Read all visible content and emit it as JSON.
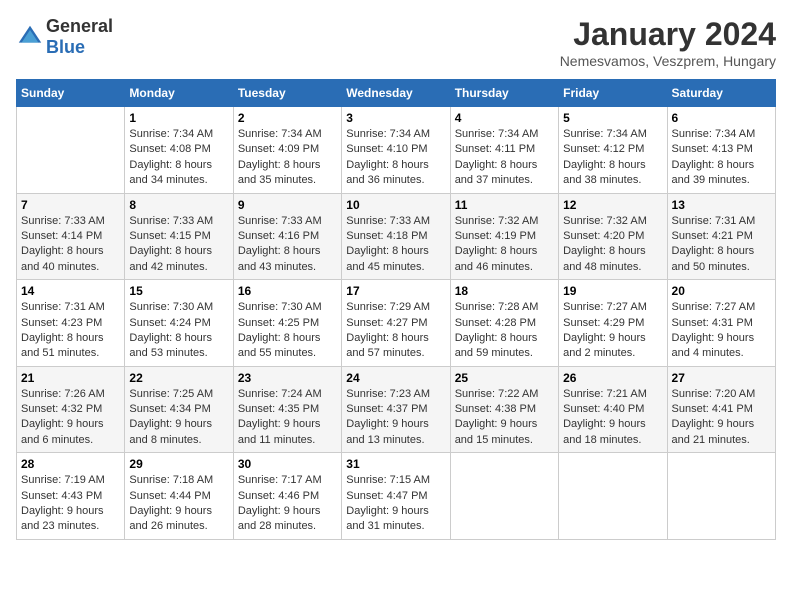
{
  "header": {
    "logo": {
      "text_general": "General",
      "text_blue": "Blue"
    },
    "title": "January 2024",
    "subtitle": "Nemesvamos, Veszprem, Hungary"
  },
  "calendar": {
    "days_of_week": [
      "Sunday",
      "Monday",
      "Tuesday",
      "Wednesday",
      "Thursday",
      "Friday",
      "Saturday"
    ],
    "weeks": [
      [
        {
          "day": "",
          "sunrise": "",
          "sunset": "",
          "daylight": ""
        },
        {
          "day": "1",
          "sunrise": "Sunrise: 7:34 AM",
          "sunset": "Sunset: 4:08 PM",
          "daylight": "Daylight: 8 hours and 34 minutes."
        },
        {
          "day": "2",
          "sunrise": "Sunrise: 7:34 AM",
          "sunset": "Sunset: 4:09 PM",
          "daylight": "Daylight: 8 hours and 35 minutes."
        },
        {
          "day": "3",
          "sunrise": "Sunrise: 7:34 AM",
          "sunset": "Sunset: 4:10 PM",
          "daylight": "Daylight: 8 hours and 36 minutes."
        },
        {
          "day": "4",
          "sunrise": "Sunrise: 7:34 AM",
          "sunset": "Sunset: 4:11 PM",
          "daylight": "Daylight: 8 hours and 37 minutes."
        },
        {
          "day": "5",
          "sunrise": "Sunrise: 7:34 AM",
          "sunset": "Sunset: 4:12 PM",
          "daylight": "Daylight: 8 hours and 38 minutes."
        },
        {
          "day": "6",
          "sunrise": "Sunrise: 7:34 AM",
          "sunset": "Sunset: 4:13 PM",
          "daylight": "Daylight: 8 hours and 39 minutes."
        }
      ],
      [
        {
          "day": "7",
          "sunrise": "Sunrise: 7:33 AM",
          "sunset": "Sunset: 4:14 PM",
          "daylight": "Daylight: 8 hours and 40 minutes."
        },
        {
          "day": "8",
          "sunrise": "Sunrise: 7:33 AM",
          "sunset": "Sunset: 4:15 PM",
          "daylight": "Daylight: 8 hours and 42 minutes."
        },
        {
          "day": "9",
          "sunrise": "Sunrise: 7:33 AM",
          "sunset": "Sunset: 4:16 PM",
          "daylight": "Daylight: 8 hours and 43 minutes."
        },
        {
          "day": "10",
          "sunrise": "Sunrise: 7:33 AM",
          "sunset": "Sunset: 4:18 PM",
          "daylight": "Daylight: 8 hours and 45 minutes."
        },
        {
          "day": "11",
          "sunrise": "Sunrise: 7:32 AM",
          "sunset": "Sunset: 4:19 PM",
          "daylight": "Daylight: 8 hours and 46 minutes."
        },
        {
          "day": "12",
          "sunrise": "Sunrise: 7:32 AM",
          "sunset": "Sunset: 4:20 PM",
          "daylight": "Daylight: 8 hours and 48 minutes."
        },
        {
          "day": "13",
          "sunrise": "Sunrise: 7:31 AM",
          "sunset": "Sunset: 4:21 PM",
          "daylight": "Daylight: 8 hours and 50 minutes."
        }
      ],
      [
        {
          "day": "14",
          "sunrise": "Sunrise: 7:31 AM",
          "sunset": "Sunset: 4:23 PM",
          "daylight": "Daylight: 8 hours and 51 minutes."
        },
        {
          "day": "15",
          "sunrise": "Sunrise: 7:30 AM",
          "sunset": "Sunset: 4:24 PM",
          "daylight": "Daylight: 8 hours and 53 minutes."
        },
        {
          "day": "16",
          "sunrise": "Sunrise: 7:30 AM",
          "sunset": "Sunset: 4:25 PM",
          "daylight": "Daylight: 8 hours and 55 minutes."
        },
        {
          "day": "17",
          "sunrise": "Sunrise: 7:29 AM",
          "sunset": "Sunset: 4:27 PM",
          "daylight": "Daylight: 8 hours and 57 minutes."
        },
        {
          "day": "18",
          "sunrise": "Sunrise: 7:28 AM",
          "sunset": "Sunset: 4:28 PM",
          "daylight": "Daylight: 8 hours and 59 minutes."
        },
        {
          "day": "19",
          "sunrise": "Sunrise: 7:27 AM",
          "sunset": "Sunset: 4:29 PM",
          "daylight": "Daylight: 9 hours and 2 minutes."
        },
        {
          "day": "20",
          "sunrise": "Sunrise: 7:27 AM",
          "sunset": "Sunset: 4:31 PM",
          "daylight": "Daylight: 9 hours and 4 minutes."
        }
      ],
      [
        {
          "day": "21",
          "sunrise": "Sunrise: 7:26 AM",
          "sunset": "Sunset: 4:32 PM",
          "daylight": "Daylight: 9 hours and 6 minutes."
        },
        {
          "day": "22",
          "sunrise": "Sunrise: 7:25 AM",
          "sunset": "Sunset: 4:34 PM",
          "daylight": "Daylight: 9 hours and 8 minutes."
        },
        {
          "day": "23",
          "sunrise": "Sunrise: 7:24 AM",
          "sunset": "Sunset: 4:35 PM",
          "daylight": "Daylight: 9 hours and 11 minutes."
        },
        {
          "day": "24",
          "sunrise": "Sunrise: 7:23 AM",
          "sunset": "Sunset: 4:37 PM",
          "daylight": "Daylight: 9 hours and 13 minutes."
        },
        {
          "day": "25",
          "sunrise": "Sunrise: 7:22 AM",
          "sunset": "Sunset: 4:38 PM",
          "daylight": "Daylight: 9 hours and 15 minutes."
        },
        {
          "day": "26",
          "sunrise": "Sunrise: 7:21 AM",
          "sunset": "Sunset: 4:40 PM",
          "daylight": "Daylight: 9 hours and 18 minutes."
        },
        {
          "day": "27",
          "sunrise": "Sunrise: 7:20 AM",
          "sunset": "Sunset: 4:41 PM",
          "daylight": "Daylight: 9 hours and 21 minutes."
        }
      ],
      [
        {
          "day": "28",
          "sunrise": "Sunrise: 7:19 AM",
          "sunset": "Sunset: 4:43 PM",
          "daylight": "Daylight: 9 hours and 23 minutes."
        },
        {
          "day": "29",
          "sunrise": "Sunrise: 7:18 AM",
          "sunset": "Sunset: 4:44 PM",
          "daylight": "Daylight: 9 hours and 26 minutes."
        },
        {
          "day": "30",
          "sunrise": "Sunrise: 7:17 AM",
          "sunset": "Sunset: 4:46 PM",
          "daylight": "Daylight: 9 hours and 28 minutes."
        },
        {
          "day": "31",
          "sunrise": "Sunrise: 7:15 AM",
          "sunset": "Sunset: 4:47 PM",
          "daylight": "Daylight: 9 hours and 31 minutes."
        },
        {
          "day": "",
          "sunrise": "",
          "sunset": "",
          "daylight": ""
        },
        {
          "day": "",
          "sunrise": "",
          "sunset": "",
          "daylight": ""
        },
        {
          "day": "",
          "sunrise": "",
          "sunset": "",
          "daylight": ""
        }
      ]
    ]
  }
}
